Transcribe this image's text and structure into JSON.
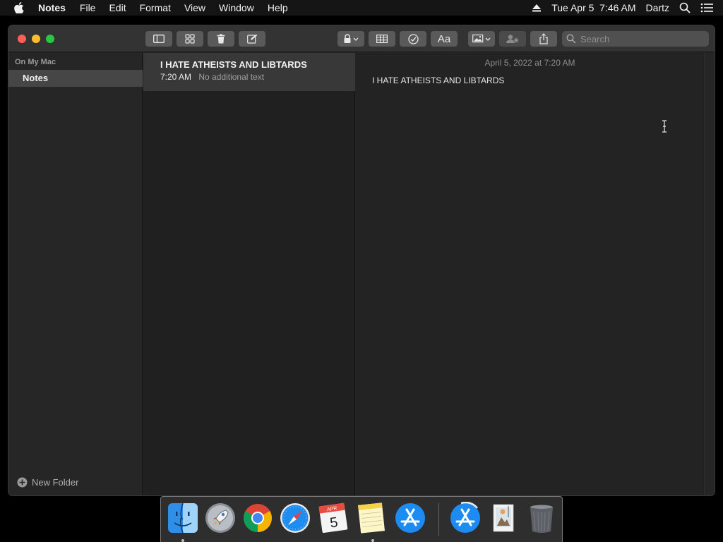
{
  "menubar": {
    "app_name": "Notes",
    "items": [
      "File",
      "Edit",
      "Format",
      "View",
      "Window",
      "Help"
    ],
    "datetime": "Tue Apr 5  7:46 AM",
    "user": "Dartz"
  },
  "sidebar": {
    "section_label": "On My Mac",
    "folder_label": "Notes",
    "new_folder_label": "New Folder"
  },
  "toolbar": {
    "format_label": "Aa",
    "search_placeholder": "Search"
  },
  "note_list": {
    "items": [
      {
        "title": "I HATE ATHEISTS AND LIBTARDS",
        "time": "7:20 AM",
        "preview": "No additional text"
      }
    ]
  },
  "editor": {
    "date": "April 5, 2022 at 7:20 AM",
    "body": "I HATE ATHEISTS AND LIBTARDS"
  },
  "calendar_icon": {
    "month": "APR",
    "day": "5"
  },
  "colors": {
    "close": "#fe5f57",
    "minimize": "#febc2e",
    "maximize": "#28c840",
    "selection": "#464646"
  },
  "dock": {
    "apps": [
      "finder-icon",
      "launchpad-icon",
      "chrome-icon",
      "safari-icon",
      "calendar-icon",
      "notes-icon",
      "app-store-icon",
      "app-store-download-icon",
      "preview-icon",
      "trash-icon"
    ]
  }
}
